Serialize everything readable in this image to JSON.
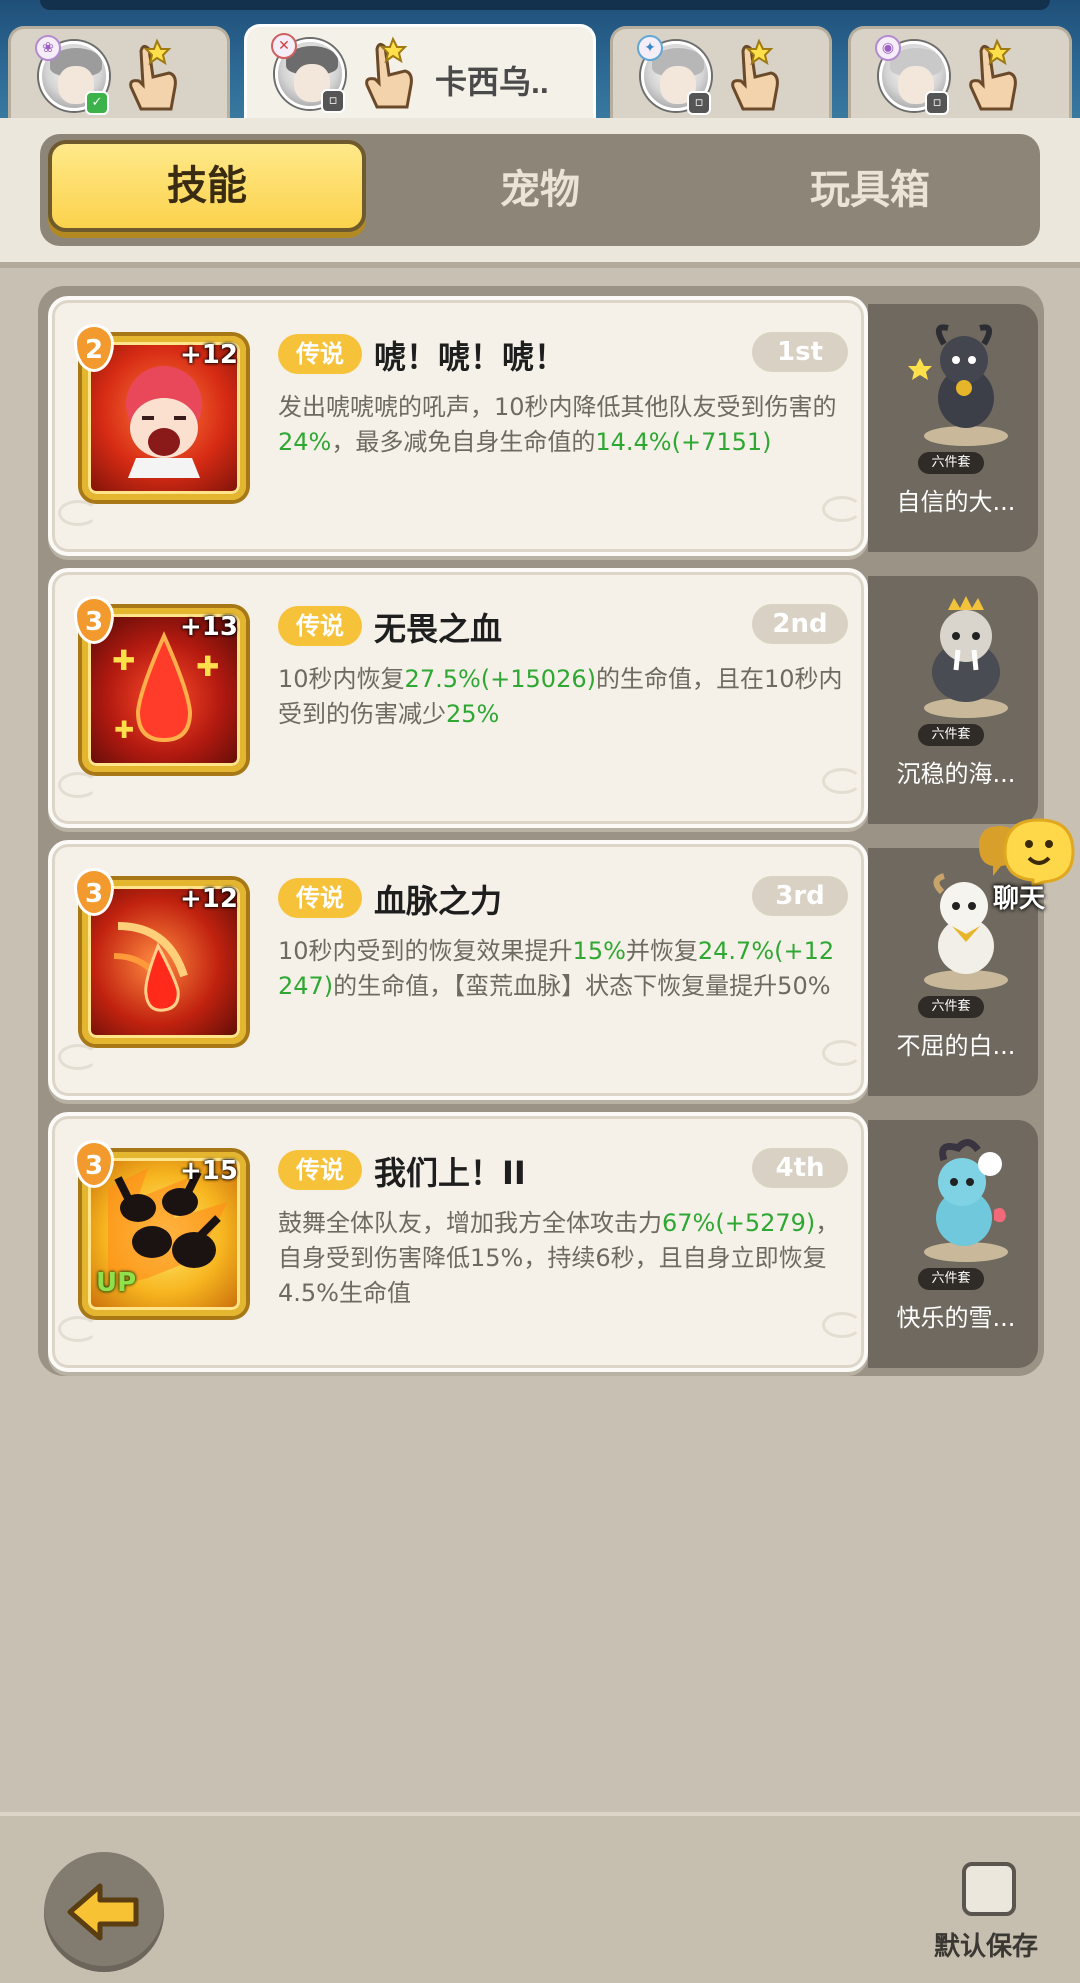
{
  "hero_tabs": [
    {
      "name": "",
      "status": "online",
      "active": false
    },
    {
      "name": "卡西乌..",
      "status": "away",
      "active": true
    },
    {
      "name": "",
      "status": "away",
      "active": false
    },
    {
      "name": "",
      "status": "away",
      "active": false
    }
  ],
  "category_tabs": [
    {
      "label": "技能",
      "active": true
    },
    {
      "label": "宠物",
      "active": false
    },
    {
      "label": "玩具箱",
      "active": false
    }
  ],
  "skills": [
    {
      "rarity": "传说",
      "name": "唬！唬！唬！",
      "rank": "1st",
      "level": "2",
      "bonus": "+12",
      "up": "",
      "desc_parts": [
        "发出唬唬唬的吼声，10秒内降低其他队友受到伤害的",
        "24%",
        "，最多减免自身生命值的",
        "14.4%",
        "(+7151)"
      ],
      "pet_name": "自信的大...",
      "pet_set": "六件套"
    },
    {
      "rarity": "传说",
      "name": "无畏之血",
      "rank": "2nd",
      "level": "3",
      "bonus": "+13",
      "up": "",
      "desc_parts": [
        "10秒内恢复",
        "27.5%",
        "(+15026)",
        "的生命值，且在10秒内受到的伤害减少",
        "25%"
      ],
      "pet_name": "沉稳的海...",
      "pet_set": "六件套"
    },
    {
      "rarity": "传说",
      "name": "血脉之力",
      "rank": "3rd",
      "level": "3",
      "bonus": "+12",
      "up": "",
      "desc_parts": [
        "10秒内受到的恢复效果提升",
        "15%",
        "并恢复",
        "24.7%",
        "(+12247)",
        "的生命值，【蛮荒血脉】状态下恢复量提升50%"
      ],
      "pet_name": "不屈的白...",
      "pet_set": "六件套"
    },
    {
      "rarity": "传说",
      "name": "我们上！II",
      "rank": "4th",
      "level": "3",
      "bonus": "+15",
      "up": "UP",
      "desc_parts": [
        "鼓舞全体队友，增加我方全体攻击力",
        "67%",
        "(+5279)",
        "，自身受到伤害降低15%，持续6秒，且自身立即恢复4.5%生命值"
      ],
      "pet_name": "快乐的雪...",
      "pet_set": "六件套"
    }
  ],
  "chat": {
    "label": "聊天"
  },
  "bottom": {
    "save_label": "默认保存"
  },
  "colors": {
    "highlight": "#2fa733",
    "rarity_gold": "#f5c23a",
    "tab_active": "#fbd24c"
  }
}
